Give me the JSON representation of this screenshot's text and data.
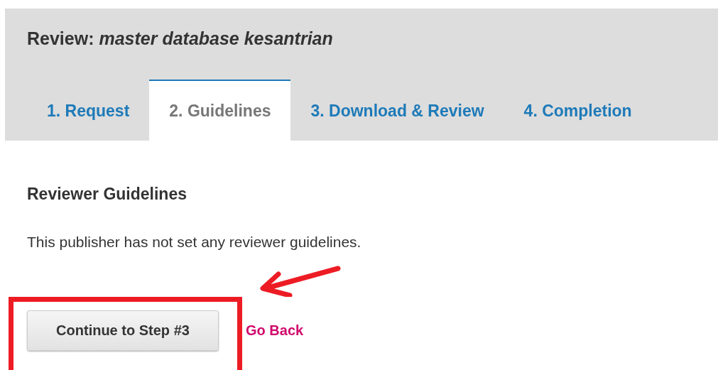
{
  "header": {
    "title_prefix": "Review:",
    "title_name": "master database kesantrian"
  },
  "tabs": [
    {
      "label": "1. Request",
      "selected": false
    },
    {
      "label": "2. Guidelines",
      "selected": true
    },
    {
      "label": "3. Download & Review",
      "selected": false
    },
    {
      "label": "4. Completion",
      "selected": false
    }
  ],
  "section": {
    "heading": "Reviewer Guidelines",
    "text": "This publisher has not set any reviewer guidelines."
  },
  "actions": {
    "primary": "Continue to Step #3",
    "secondary": "Go Back"
  }
}
